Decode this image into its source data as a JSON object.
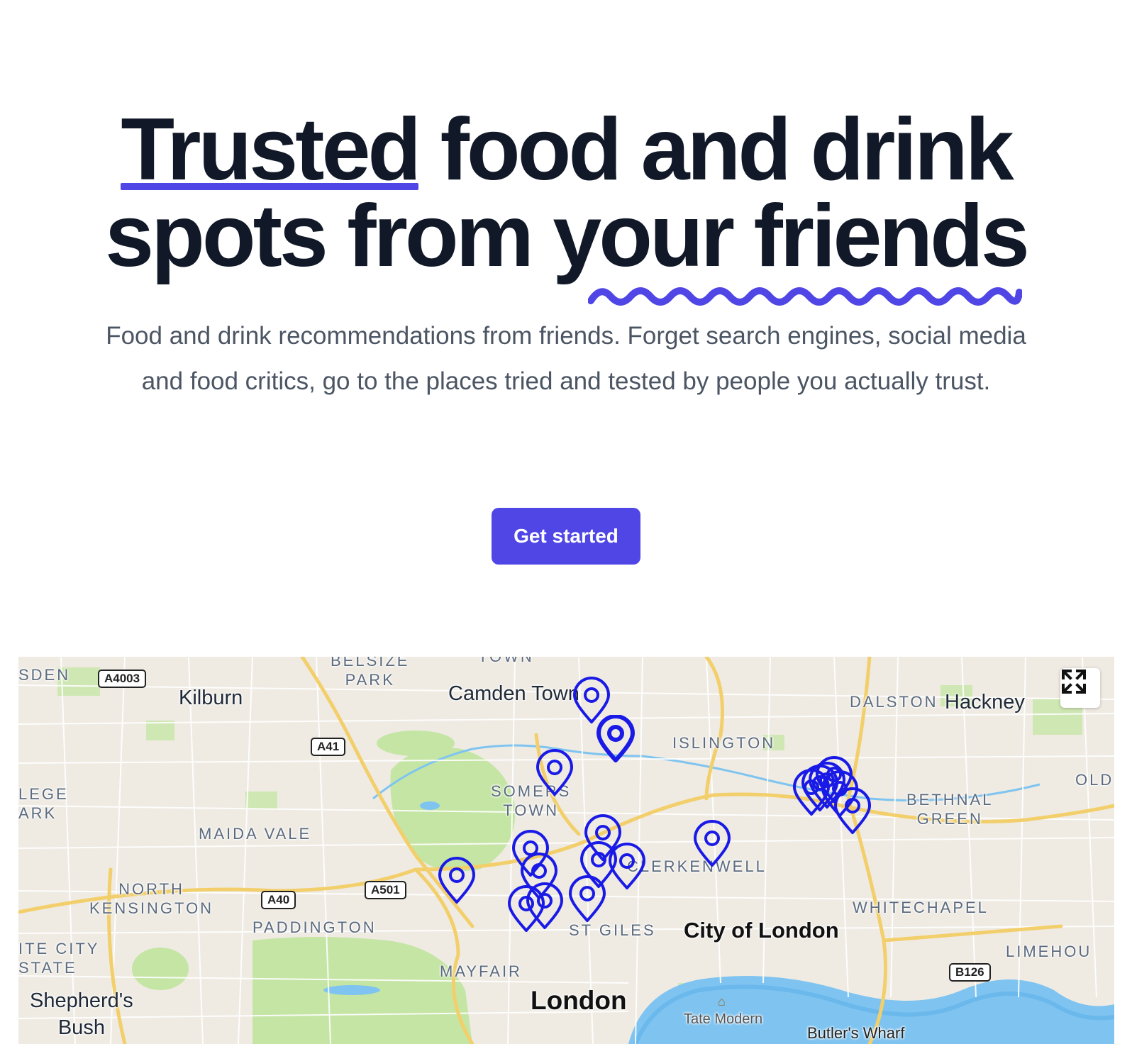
{
  "hero": {
    "headline": {
      "emphasis": "Trusted",
      "middle": " food and drink",
      "line2_start": "spots from ",
      "wavy": "your friends"
    },
    "subtitle": "Food and drink recommendations from friends. Forget search engines, social media and food critics, go to the places tried and tested by people you actually trust.",
    "cta_label": "Get started",
    "accent_color": "#4f46e5"
  },
  "map": {
    "pin_color": "#1a1ae6",
    "pin_count": 19,
    "labels": {
      "sden": "SDEN",
      "belsize": "BELSIZE\nPARK",
      "town_top": "TOWN",
      "kilburn": "Kilburn",
      "camden": "Camden Town",
      "dalston": "DALSTON",
      "hackney": "Hackney",
      "islington": "ISLINGTON",
      "somers": "SOMERS\nTOWN",
      "lege": "LEGE\nARK",
      "bethnal": "BETHNAL\nGREEN",
      "old": "OLD",
      "maida": "MAIDA VALE",
      "clerkenwell": "CLERKENWELL",
      "north_ken": "NORTH\nKENSINGTON",
      "paddington": "PADDINGTON",
      "stgiles": "ST GILES",
      "city_of_london": "City of London",
      "whitechapel": "WHITECHAPEL",
      "white_city": "ITE CITY\nSTATE",
      "limehouse": "LIMEHOU",
      "mayfair": "MAYFAIR",
      "london": "London",
      "shepherds": "Shepherd's\nBush",
      "tate": "Tate Modern",
      "butlers": "Butler's Wharf"
    },
    "roads": {
      "a4003": "A4003",
      "a41": "A41",
      "a501": "A501",
      "a40": "A40",
      "b126": "B126"
    }
  }
}
